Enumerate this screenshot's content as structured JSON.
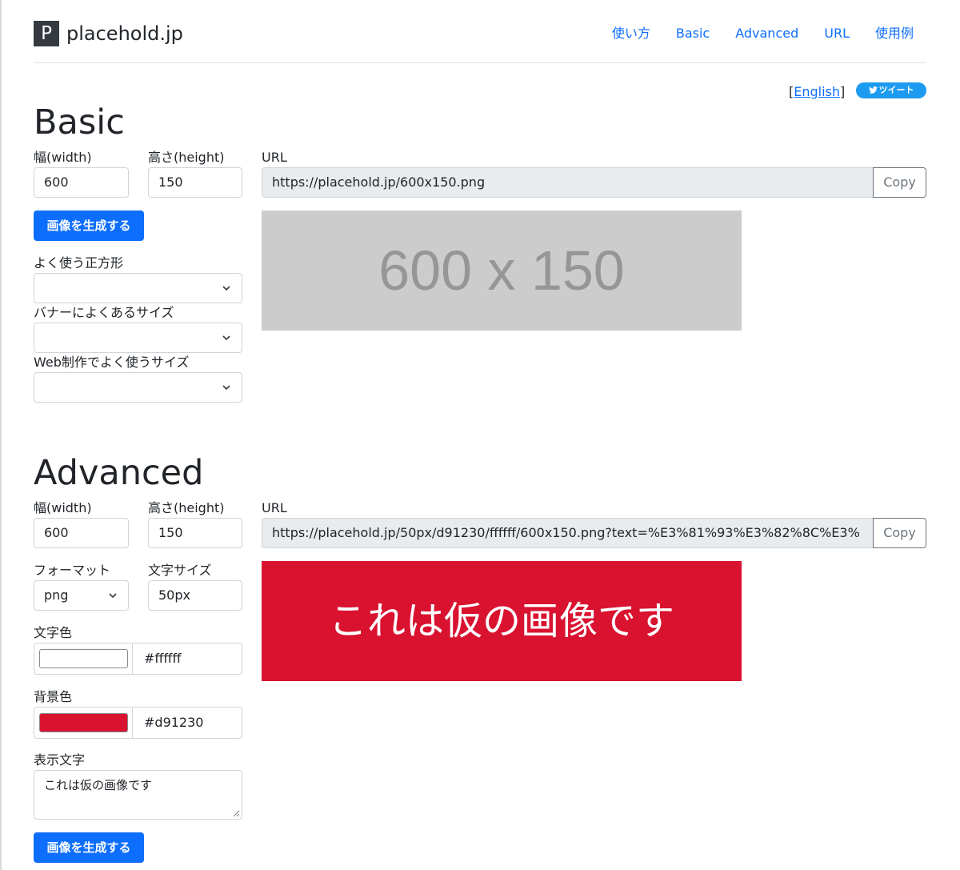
{
  "header": {
    "logo_letter": "P",
    "site_name": "placehold.jp",
    "nav": [
      "使い方",
      "Basic",
      "Advanced",
      "URL",
      "使用例"
    ]
  },
  "lang": {
    "open": "[",
    "link": "English",
    "close": "]"
  },
  "tweet_label": "ツイート",
  "basic": {
    "title": "Basic",
    "width_label": "幅(width)",
    "width_value": "600",
    "height_label": "高さ(height)",
    "height_value": "150",
    "generate_label": "画像を生成する",
    "square_label": "よく使う正方形",
    "banner_label": "バナーによくあるサイズ",
    "web_label": "Web制作でよく使うサイズ",
    "url_label": "URL",
    "url_value": "https://placehold.jp/600x150.png",
    "copy_label": "Copy",
    "preview_text": "600 x 150",
    "preview_bg": "#cccccc",
    "preview_fg": "#969696"
  },
  "advanced": {
    "title": "Advanced",
    "width_label": "幅(width)",
    "width_value": "600",
    "height_label": "高さ(height)",
    "height_value": "150",
    "format_label": "フォーマット",
    "format_value": "png",
    "fontsize_label": "文字サイズ",
    "fontsize_value": "50px",
    "textcolor_label": "文字色",
    "textcolor_value": "#ffffff",
    "bgcolor_label": "背景色",
    "bgcolor_value": "#d91230",
    "text_label": "表示文字",
    "text_value": "これは仮の画像です",
    "generate_label": "画像を生成する",
    "url_label": "URL",
    "url_value": "https://placehold.jp/50px/d91230/ffffff/600x150.png?text=%E3%81%93%E3%82%8C%E3%",
    "copy_label": "Copy",
    "preview_text": "これは仮の画像です"
  },
  "colors": {
    "accent": "#0d6efd",
    "border": "#ced4da",
    "preview_red": "#d91230"
  }
}
